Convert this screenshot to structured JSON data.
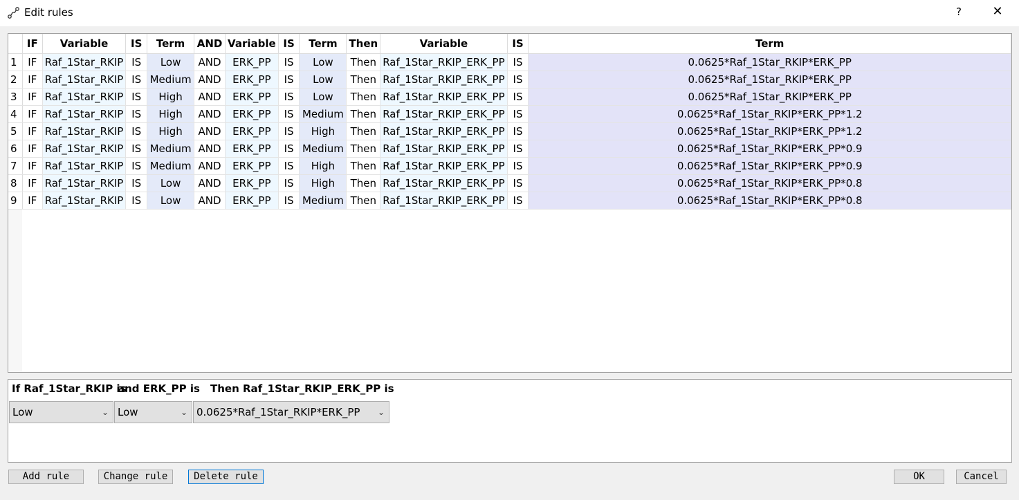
{
  "window": {
    "title": "Edit rules",
    "help_label": "?",
    "close_label": "✕"
  },
  "table": {
    "headers": [
      "IF",
      "Variable",
      "IS",
      "Term",
      "AND",
      "Variable",
      "IS",
      "Term",
      "Then",
      "Variable",
      "IS",
      "Term"
    ],
    "rows": [
      [
        "1",
        "IF",
        "Raf_1Star_RKIP",
        "IS",
        "Low",
        "AND",
        "ERK_PP",
        "IS",
        "Low",
        "Then",
        "Raf_1Star_RKIP_ERK_PP",
        "IS",
        "0.0625*Raf_1Star_RKIP*ERK_PP"
      ],
      [
        "2",
        "IF",
        "Raf_1Star_RKIP",
        "IS",
        "Medium",
        "AND",
        "ERK_PP",
        "IS",
        "Low",
        "Then",
        "Raf_1Star_RKIP_ERK_PP",
        "IS",
        "0.0625*Raf_1Star_RKIP*ERK_PP"
      ],
      [
        "3",
        "IF",
        "Raf_1Star_RKIP",
        "IS",
        "High",
        "AND",
        "ERK_PP",
        "IS",
        "Low",
        "Then",
        "Raf_1Star_RKIP_ERK_PP",
        "IS",
        "0.0625*Raf_1Star_RKIP*ERK_PP"
      ],
      [
        "4",
        "IF",
        "Raf_1Star_RKIP",
        "IS",
        "High",
        "AND",
        "ERK_PP",
        "IS",
        "Medium",
        "Then",
        "Raf_1Star_RKIP_ERK_PP",
        "IS",
        "0.0625*Raf_1Star_RKIP*ERK_PP*1.2"
      ],
      [
        "5",
        "IF",
        "Raf_1Star_RKIP",
        "IS",
        "High",
        "AND",
        "ERK_PP",
        "IS",
        "High",
        "Then",
        "Raf_1Star_RKIP_ERK_PP",
        "IS",
        "0.0625*Raf_1Star_RKIP*ERK_PP*1.2"
      ],
      [
        "6",
        "IF",
        "Raf_1Star_RKIP",
        "IS",
        "Medium",
        "AND",
        "ERK_PP",
        "IS",
        "Medium",
        "Then",
        "Raf_1Star_RKIP_ERK_PP",
        "IS",
        "0.0625*Raf_1Star_RKIP*ERK_PP*0.9"
      ],
      [
        "7",
        "IF",
        "Raf_1Star_RKIP",
        "IS",
        "Medium",
        "AND",
        "ERK_PP",
        "IS",
        "High",
        "Then",
        "Raf_1Star_RKIP_ERK_PP",
        "IS",
        "0.0625*Raf_1Star_RKIP*ERK_PP*0.9"
      ],
      [
        "8",
        "IF",
        "Raf_1Star_RKIP",
        "IS",
        "Low",
        "AND",
        "ERK_PP",
        "IS",
        "High",
        "Then",
        "Raf_1Star_RKIP_ERK_PP",
        "IS",
        "0.0625*Raf_1Star_RKIP*ERK_PP*0.8"
      ],
      [
        "9",
        "IF",
        "Raf_1Star_RKIP",
        "IS",
        "Low",
        "AND",
        "ERK_PP",
        "IS",
        "Medium",
        "Then",
        "Raf_1Star_RKIP_ERK_PP",
        "IS",
        "0.0625*Raf_1Star_RKIP*ERK_PP*0.8"
      ]
    ]
  },
  "editor": {
    "if_label": "If Raf_1Star_RKIP is",
    "and_label": "and ERK_PP is",
    "then_label": "Then Raf_1Star_RKIP_ERK_PP is",
    "if_value": "Low",
    "and_value": "Low",
    "then_value": "0.0625*Raf_1Star_RKIP*ERK_PP"
  },
  "buttons": {
    "add_rule": "Add rule",
    "change_rule": "Change rule",
    "delete_rule": "Delete rule",
    "ok": "OK",
    "cancel": "Cancel"
  }
}
